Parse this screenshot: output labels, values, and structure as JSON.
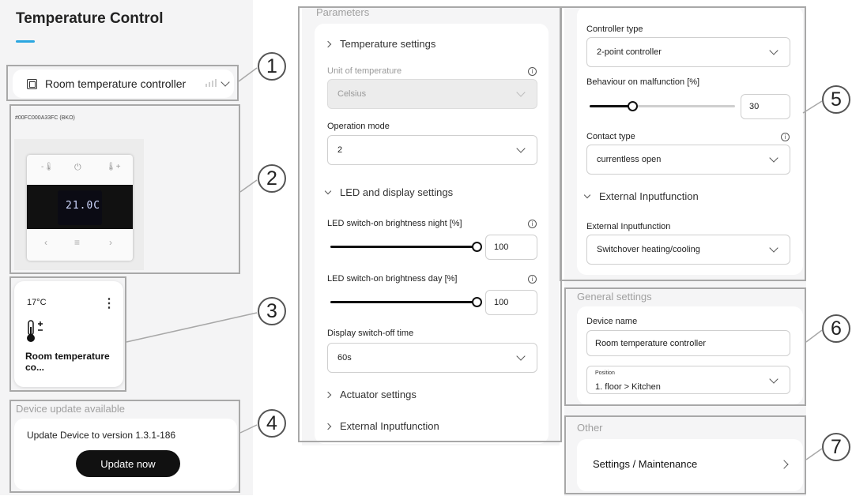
{
  "header": {
    "title": "Temperature Control",
    "accent_color": "#2aa6e0"
  },
  "device_selector": {
    "name": "Room temperature controller",
    "icon": "square-device-icon"
  },
  "device_image": {
    "id_text": "#00FC000A33FC (BKO)",
    "display_value": "21.0C"
  },
  "tile": {
    "temperature": "17°C",
    "menu_symbol": "⋮",
    "name": "Room temperature co...",
    "icon": "thermometer-icon"
  },
  "update": {
    "section_title": "Device update available",
    "message": "Update Device to version 1.3.1-186",
    "button_label": "Update now"
  },
  "parameters": {
    "section_title": "Parameters",
    "temperature_settings": {
      "title": "Temperature settings"
    },
    "unit": {
      "label": "Unit of temperature",
      "value": "Celsius"
    },
    "operation_mode": {
      "label": "Operation mode",
      "value": "2"
    },
    "led_display": {
      "title": "LED and display settings"
    },
    "led_night": {
      "label": "LED switch-on brightness night [%]",
      "value": "100",
      "level_percent": 100
    },
    "led_day": {
      "label": "LED switch-on brightness day [%]",
      "value": "100",
      "level_percent": 100
    },
    "display_off": {
      "label": "Display switch-off time",
      "value": "60s"
    },
    "actuator": {
      "title": "Actuator settings"
    },
    "external_input": {
      "title": "External Inputfunction"
    }
  },
  "controller": {
    "controller_type": {
      "label": "Controller type",
      "value": "2-point controller"
    },
    "malfunction": {
      "label": "Behaviour on malfunction [%]",
      "value": "30",
      "level_percent": 30
    },
    "contact_type": {
      "label": "Contact type",
      "value": "currentless open"
    },
    "external_section": {
      "title": "External Inputfunction"
    },
    "external_input": {
      "label": "External Inputfunction",
      "value": "Switchover heating/cooling"
    }
  },
  "general": {
    "section_title": "General settings",
    "device_name": {
      "label": "Device name",
      "value": "Room temperature controller"
    },
    "position": {
      "label": "Position",
      "value": "1. floor > Kitchen"
    }
  },
  "other": {
    "section_title": "Other",
    "settings_label": "Settings / Maintenance"
  },
  "callouts": [
    "1",
    "2",
    "3",
    "4",
    "5",
    "6",
    "7"
  ]
}
